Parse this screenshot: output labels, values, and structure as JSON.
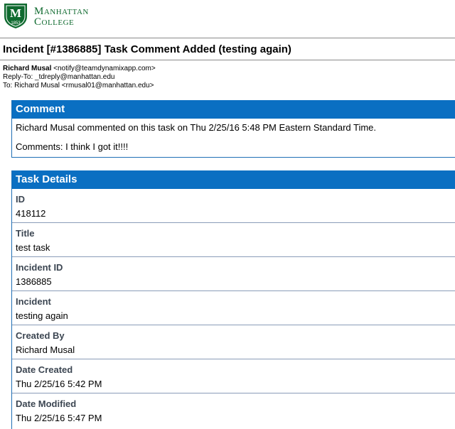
{
  "brand": {
    "line1_cap": "M",
    "line1_rest": "ANHATTAN",
    "line2_cap": "C",
    "line2_rest": "OLLEGE",
    "shield_letter": "M",
    "shield_year": "1853",
    "color": "#0f6a2f"
  },
  "email": {
    "subject": "Incident [#1386885] Task Comment Added (testing again)",
    "from_name": "Richard Musal",
    "from_addr": " <notify@teamdynamixapp.com>",
    "reply_to": "Reply-To: _tdreply@manhattan.edu",
    "to": "To: Richard Musal <rmusal01@manhattan.edu>"
  },
  "comment": {
    "heading": "Comment",
    "line1": "Richard Musal commented on this task on Thu 2/25/16 5:48 PM Eastern Standard Time.",
    "line2": "Comments: I think I got it!!!!"
  },
  "task": {
    "heading": "Task Details",
    "fields": [
      {
        "label": "ID",
        "value": "418112"
      },
      {
        "label": "Title",
        "value": "test task"
      },
      {
        "label": "Incident ID",
        "value": "1386885"
      },
      {
        "label": "Incident",
        "value": "testing again"
      },
      {
        "label": "Created By",
        "value": "Richard Musal"
      },
      {
        "label": "Date Created",
        "value": "Thu 2/25/16 5:42 PM"
      },
      {
        "label": "Date Modified",
        "value": "Thu 2/25/16 5:47 PM"
      }
    ]
  },
  "colors": {
    "panel_header": "#0a6fc2",
    "label": "#3c4652"
  }
}
